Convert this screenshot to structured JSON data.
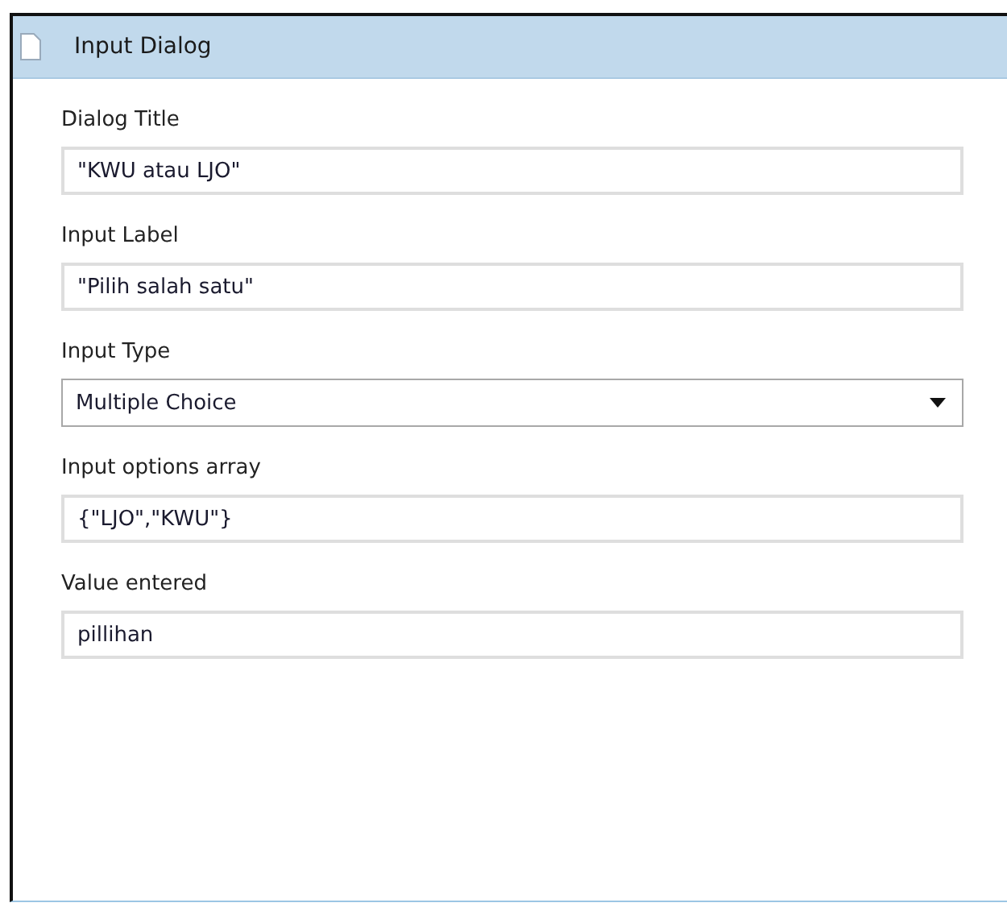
{
  "panel": {
    "title": "Input Dialog"
  },
  "fields": [
    {
      "label": "Dialog Title",
      "kind": "text",
      "value": "\"KWU atau LJO\""
    },
    {
      "label": "Input Label",
      "kind": "text",
      "value": "\"Pilih salah satu\""
    },
    {
      "label": "Input Type",
      "kind": "select",
      "value": "Multiple Choice"
    },
    {
      "label": "Input options array",
      "kind": "text",
      "value": "{\"LJO\",\"KWU\"}"
    },
    {
      "label": "Value entered",
      "kind": "text",
      "value": "pillihan"
    }
  ]
}
